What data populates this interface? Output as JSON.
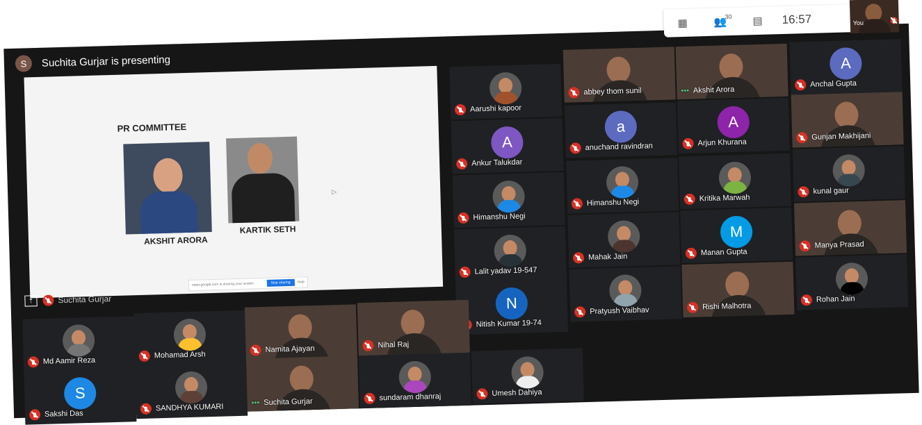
{
  "toolbar": {
    "participants_count": "30",
    "time": "16:57",
    "you_label": "You"
  },
  "presenting": {
    "avatar_letter": "S",
    "title": "Suchita Gurjar is presenting",
    "footer_name": "Suchita Gurjar",
    "slide": {
      "heading": "PR COMMITTEE",
      "members": [
        "AKSHIT ARORA",
        "KARTIK SETH"
      ],
      "share_notice": "meet.google.com is sharing your screen.",
      "stop_label": "Stop sharing",
      "hide_label": "Hide"
    }
  },
  "participants": [
    {
      "name": "Aarushi kapoor",
      "type": "photo",
      "color": "#a0522d"
    },
    {
      "name": "abbey thom sunil",
      "type": "video"
    },
    {
      "name": "Akshit Arora",
      "type": "video",
      "speaking": true
    },
    {
      "name": "Anchal Gupta",
      "type": "letter",
      "letter": "A",
      "color": "#5c6bc0"
    },
    {
      "name": "Ankur Talukdar",
      "type": "letter",
      "letter": "A",
      "color": "#7e57c2"
    },
    {
      "name": "anuchand ravindran",
      "type": "letter",
      "letter": "a",
      "color": "#5c6bc0"
    },
    {
      "name": "Arjun Khurana",
      "type": "letter",
      "letter": "A",
      "color": "#8e24aa"
    },
    {
      "name": "Gunjan Makhijani",
      "type": "video"
    },
    {
      "name": "Himanshu Negi",
      "type": "photo",
      "color": "#1e88e5"
    },
    {
      "name": "Himanshu Negi",
      "type": "photo",
      "color": "#1e88e5"
    },
    {
      "name": "Kritika Marwah",
      "type": "photo",
      "color": "#7cb342"
    },
    {
      "name": "kunal gaur",
      "type": "photo",
      "color": "#37474f"
    },
    {
      "name": "Lalit yadav 19-547",
      "type": "photo",
      "color": "#263238"
    },
    {
      "name": "Mahak Jain",
      "type": "photo",
      "color": "#4e342e"
    },
    {
      "name": "Manan Gupta",
      "type": "letter",
      "letter": "M",
      "color": "#039be5"
    },
    {
      "name": "Manya Prasad",
      "type": "video"
    },
    {
      "name": "Nitish Kumar 19-74",
      "type": "letter",
      "letter": "N",
      "color": "#1565c0"
    },
    {
      "name": "Pratyush Vaibhav",
      "type": "photo",
      "color": "#90a4ae"
    },
    {
      "name": "Rishi Malhotra",
      "type": "video"
    },
    {
      "name": "Rohan Jain",
      "type": "photo",
      "color": "#000000"
    },
    {
      "name": "Md Aamir Reza",
      "type": "photo",
      "color": "#757575"
    },
    {
      "name": "Mohamad Arsh",
      "type": "photo",
      "color": "#fbc02d"
    },
    {
      "name": "Namita Ajayan",
      "type": "video"
    },
    {
      "name": "Nihal Raj",
      "type": "video"
    },
    {
      "name": "Sakshi Das",
      "type": "letter",
      "letter": "S",
      "color": "#1e88e5"
    },
    {
      "name": "SANDHYA KUMARI",
      "type": "photo",
      "color": "#5d4037"
    },
    {
      "name": "Suchita Gurjar",
      "type": "video",
      "speaking": true
    },
    {
      "name": "sundaram dhanraj",
      "type": "photo",
      "color": "#ab47bc"
    },
    {
      "name": "Umesh Dahiya",
      "type": "photo",
      "color": "#eeeeee"
    }
  ]
}
